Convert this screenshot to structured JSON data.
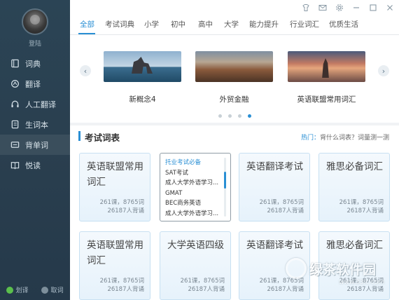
{
  "sidebar": {
    "login_label": "登陆",
    "items": [
      {
        "label": "词典",
        "icon": "book-icon"
      },
      {
        "label": "翻译",
        "icon": "translate-icon"
      },
      {
        "label": "人工翻译",
        "icon": "headset-icon"
      },
      {
        "label": "生词本",
        "icon": "notebook-icon"
      },
      {
        "label": "背单词",
        "icon": "flashcard-icon"
      },
      {
        "label": "悦读",
        "icon": "open-book-icon"
      }
    ],
    "bottom": [
      {
        "label": "划译",
        "icon": "toggle-on-icon"
      },
      {
        "label": "取词",
        "icon": "toggle-off-icon"
      }
    ]
  },
  "window_controls": [
    "skin-icon",
    "mail-icon",
    "gear-icon",
    "minimize-icon",
    "maximize-icon",
    "close-icon"
  ],
  "tabs": [
    "全部",
    "考试词典",
    "小学",
    "初中",
    "高中",
    "大学",
    "能力提升",
    "行业词汇",
    "优质生活"
  ],
  "carousel": {
    "slides": [
      {
        "caption": "新概念4"
      },
      {
        "caption": "外贸金融"
      },
      {
        "caption": "英语联盟常用词汇"
      }
    ],
    "active_dot": 3,
    "dot_count": 4
  },
  "section": {
    "title": "考试词表",
    "hot_label": "热门：",
    "hot_text": "背什么词表？词量测一测"
  },
  "cards_row1": [
    {
      "title": "英语联盟常用词汇",
      "meta1": "261课，8765词",
      "meta2": "26187人背诵"
    },
    {
      "title": "英语翻译考试",
      "meta1": "261课，8765词",
      "meta2": "26187人背诵"
    },
    {
      "title": "雅思必备词汇",
      "meta1": "261课，8765词",
      "meta2": "26187人背诵"
    }
  ],
  "dropdown": {
    "options": [
      "托业考试必备",
      "SAT考试",
      "成人大学外语学习...",
      "GMAT",
      "BEC商务英语",
      "成人大学外语学习..."
    ]
  },
  "cards_row2": [
    {
      "title": "英语联盟常用词汇",
      "meta1": "261课，8765词",
      "meta2": "26187人背诵"
    },
    {
      "title": "大学英语四级",
      "meta1": "261课，8765词",
      "meta2": "26187人背诵"
    },
    {
      "title": "英语翻译考试",
      "meta1": "261课，8765词",
      "meta2": "26187人背诵"
    },
    {
      "title": "雅思必备词汇",
      "meta1": "261课，8765词",
      "meta2": "26187人背诵"
    }
  ],
  "watermark": {
    "text": "绿茶软件园",
    "url": "www.33lc.com"
  }
}
